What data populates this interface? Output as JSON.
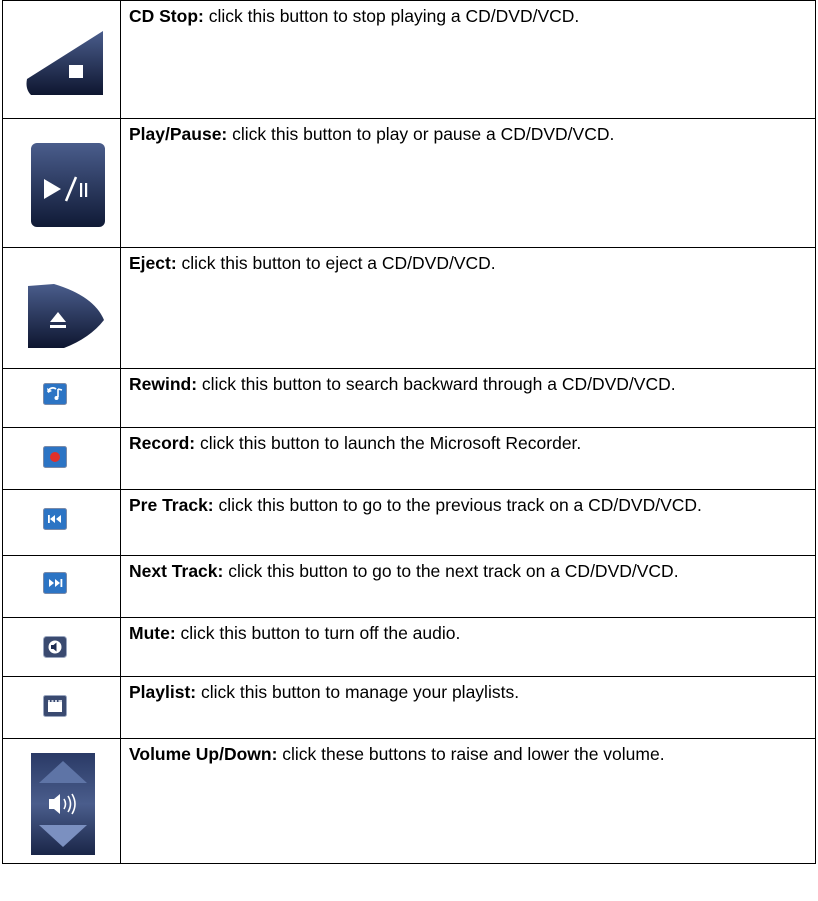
{
  "rows": [
    {
      "icon": "cd-stop-icon",
      "term": "CD Stop:",
      "text": " click this button to stop playing a CD/DVD/VCD."
    },
    {
      "icon": "play-pause-icon",
      "term": "Play/Pause:",
      "text": " click this button to play or pause a CD/DVD/VCD."
    },
    {
      "icon": "eject-icon",
      "term": "Eject:",
      "text": " click this button to eject a CD/DVD/VCD."
    },
    {
      "icon": "rewind-icon",
      "term": "Rewind:",
      "text": " click this button to search backward through a CD/DVD/VCD."
    },
    {
      "icon": "record-icon",
      "term": "Record:",
      "text": " click this button to launch the Microsoft Recorder."
    },
    {
      "icon": "previous-track-icon",
      "term": "Pre Track:",
      "text": " click this button to go to the previous track on a CD/DVD/VCD."
    },
    {
      "icon": "next-track-icon",
      "term": "Next Track:",
      "text": " click this button to go to the next track on a CD/DVD/VCD."
    },
    {
      "icon": "mute-icon",
      "term": "Mute:",
      "text": " click this button to turn off the audio."
    },
    {
      "icon": "playlist-icon",
      "term": "Playlist:",
      "text": " click this button to manage your playlists."
    },
    {
      "icon": "volume-up-down-icon",
      "term": "Volume Up/Down:",
      "text": " click these buttons to raise and lower the volume."
    }
  ],
  "colors": {
    "navy": "#1f2d52",
    "navy_dark": "#0e1630",
    "navy_light": "#4a5d8c",
    "record_red": "#e0302a",
    "icon_blue": "#2c74c4"
  }
}
